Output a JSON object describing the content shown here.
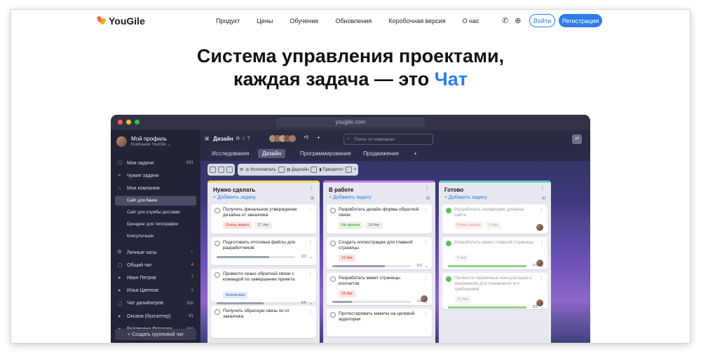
{
  "nav": {
    "brand": "YouGile",
    "menu": [
      "Продукт",
      "Цены",
      "Обучение",
      "Обновления",
      "Коробочная версия",
      "О нас"
    ],
    "login": "Войти",
    "register": "Регистрация"
  },
  "hero": {
    "line1": "Система управления проектами,",
    "line2": "каждая задача — это",
    "accent": "Чат"
  },
  "app": {
    "url": "yougile.com",
    "profile": {
      "name": "Мой профиль",
      "company": "Компания YouGile ⌄"
    },
    "sidebar": [
      {
        "label": "Мои задачи",
        "count": "631",
        "icon": "☐"
      },
      {
        "label": "Чужие задачи",
        "count": "",
        "icon": "≡"
      },
      {
        "label": "Моя компания",
        "count": "",
        "icon": "⌂"
      },
      {
        "label": "Сайт для банка",
        "sub": true,
        "selected": true
      },
      {
        "label": "Сайт для службы доставки",
        "sub": true
      },
      {
        "label": "Брендинг для типографии",
        "sub": true
      },
      {
        "label": "Консультации",
        "sub": true
      }
    ],
    "chats_header": "Личные чаты",
    "chats": [
      {
        "label": "Общий чат",
        "count": "4",
        "orange": true,
        "icon": "▢"
      },
      {
        "label": "Иван Петров",
        "count": "7",
        "orange": true,
        "icon": "●"
      },
      {
        "label": "Илья Цветков",
        "count": "2",
        "icon": "●"
      },
      {
        "label": "Чат дизайнеров",
        "count": "330",
        "icon": "▢"
      },
      {
        "label": "Оксана (бухгалтер)",
        "count": "81",
        "icon": "●"
      },
      {
        "label": "Екатерина Фролова",
        "count": "590",
        "icon": "●"
      }
    ],
    "new_chat": "+ Создать групповой чат",
    "board_title": "Дизайн",
    "avatars_more": "+5",
    "search_placeholder": "Поиск по компании",
    "tabs": [
      "Исследования",
      "Дизайн",
      "Программирование",
      "Продвижение",
      "+"
    ],
    "toolbar": {
      "executor": "Исполнитель",
      "deadline": "Дедлайн",
      "priority": "Приоритет"
    },
    "add_task": "+ Добавить задачу",
    "columns": [
      {
        "title": "Нужно сделать",
        "color": "#f3d95a",
        "cards": [
          {
            "text": "Получить финальное утверждение дизайна от заказчика",
            "tags": [
              {
                "t": "Очень важно",
                "c": "red"
              },
              {
                "t": "27 Авг",
                "c": "gray"
              }
            ]
          },
          {
            "text": "Подготовить итоговые файлы для разработчиков",
            "progress": "2/3",
            "fill": 0.67
          },
          {
            "text": "Провести сеанс обратной связи с командой по завершении проекта",
            "tags": [
              {
                "t": "Аналитика",
                "c": "blue"
              }
            ],
            "progress": "3/5",
            "fill": 0.6
          },
          {
            "text": "Получить обратную связь по от заказчика"
          }
        ]
      },
      {
        "title": "В работе",
        "color": "#c77ae0",
        "cards": [
          {
            "text": "Разработать дизайн формы обратной связи",
            "tags": [
              {
                "t": "Не срочно",
                "c": "green"
              },
              {
                "t": "18 Авг",
                "c": "gray"
              }
            ]
          },
          {
            "text": "Создать иллюстрации для главной страницы",
            "tags": [
              {
                "t": "19 Авг",
                "c": "red"
              }
            ],
            "progress": "2/3",
            "fill": 0.67
          },
          {
            "text": "Разработать макет страницы контактов",
            "tags": [
              {
                "t": "18 Авг",
                "c": "red"
              }
            ],
            "progress": "1/4",
            "fill": 0.25
          },
          {
            "text": "Протестировать макеты на целевой аудитории"
          }
        ]
      },
      {
        "title": "Готово",
        "color": "#5fc8c0",
        "cards": [
          {
            "text": "Разработать концепцию дизайна сайта",
            "done": true,
            "tags": [
              {
                "t": "Очень важно",
                "c": "red"
              },
              {
                "t": "5 Авг",
                "c": "gray"
              }
            ]
          },
          {
            "text": "Разработать макет главной страницы",
            "done": true,
            "tags": [
              {
                "t": "9 Авг",
                "c": "gray"
              }
            ],
            "progress": "7/7",
            "fill": 1
          },
          {
            "text": "Провести первичные консультации с заказчиком для понимания его требований",
            "done": true,
            "tags": [
              {
                "t": "10 Авг",
                "c": "gray"
              }
            ],
            "progress": "3/3",
            "fill": 1
          }
        ]
      }
    ]
  }
}
